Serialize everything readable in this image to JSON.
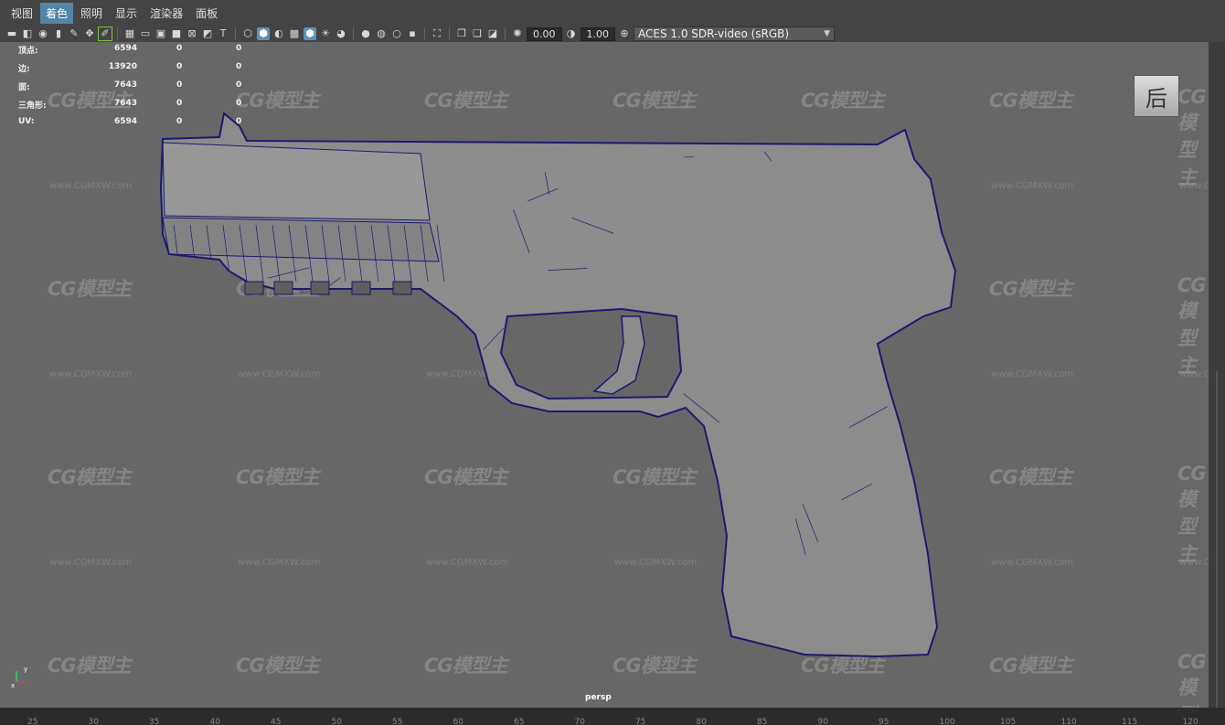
{
  "menu": [
    "视图",
    "着色",
    "照明",
    "显示",
    "渲染器",
    "面板"
  ],
  "menu_active_index": 1,
  "toolbar": {
    "exposure": "0.00",
    "gamma": "1.00",
    "color_space": "ACES 1.0 SDR-video (sRGB)",
    "icons": [
      "camera-icon",
      "camera-attr-icon",
      "bookmark-icon",
      "image-plane-icon",
      "grid-icon",
      "film-gate-icon",
      "resolution-gate-icon",
      "gate-mask-icon",
      "field-chart-icon",
      "safe-action-icon",
      "safe-title-icon",
      "wireframe-icon",
      "smooth-shade-icon",
      "default-material-icon",
      "textured-icon",
      "wireframe-on-shaded-icon",
      "lights-icon",
      "shadows-icon",
      "ambient-occlusion-icon",
      "motion-blur-icon",
      "anti-aliasing-icon",
      "depth-of-field-icon",
      "isolate-select-icon",
      "xray-icon",
      "xray-joints-icon",
      "backface-icon",
      "exposure-icon",
      "gamma-icon",
      "color-management-icon"
    ]
  },
  "hud": [
    {
      "label": "顶点:",
      "v1": "6594",
      "v2": "0",
      "v3": "0"
    },
    {
      "label": "边:",
      "v1": "13920",
      "v2": "0",
      "v3": "0"
    },
    {
      "label": "面:",
      "v1": "7643",
      "v2": "0",
      "v3": "0"
    },
    {
      "label": "三角形:",
      "v1": "7643",
      "v2": "0",
      "v3": "0"
    },
    {
      "label": "UV:",
      "v1": "6594",
      "v2": "0",
      "v3": "0"
    }
  ],
  "view_cube_label": "后",
  "camera": "persp",
  "axis": {
    "y": "y",
    "x": "x"
  },
  "watermark": {
    "logo": "CG模型主",
    "url": "www.CGMXW.com"
  },
  "ruler_ticks": [
    "25",
    "30",
    "35",
    "40",
    "45",
    "50",
    "55",
    "60",
    "65",
    "70",
    "75",
    "80",
    "85",
    "90",
    "95",
    "100",
    "105",
    "110",
    "115",
    "120"
  ],
  "colors": {
    "viewport_bg": "#676767",
    "wire": "#1e1e7a",
    "mesh": "#8a8a8a",
    "menu_active": "#5285a6"
  }
}
